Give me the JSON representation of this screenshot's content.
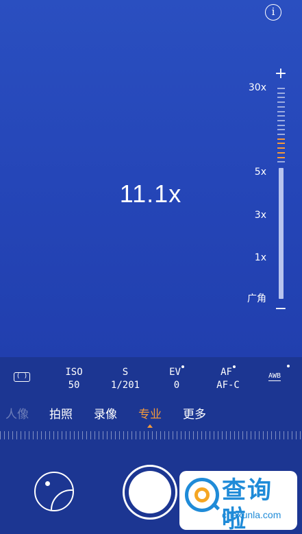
{
  "viewfinder": {
    "info_glyph": "i",
    "zoom_readout": "11.1x",
    "zoom_slider": {
      "plus": "+",
      "minus": "−",
      "labels": [
        "30x",
        "5x",
        "3x",
        "1x",
        "广角"
      ],
      "level_fraction": 0.62
    }
  },
  "pro_params": {
    "aspect_glyph": "(  )",
    "iso": {
      "name": "ISO",
      "value": "50"
    },
    "shutter": {
      "name": "S",
      "value": "1/201"
    },
    "ev": {
      "name": "EV",
      "value": "0"
    },
    "af": {
      "name": "AF",
      "value": "AF-C"
    },
    "awb": "AWB"
  },
  "modes": [
    "人像",
    "拍照",
    "录像",
    "专业",
    "更多"
  ],
  "active_mode": "专业",
  "watermark": {
    "title": "查询啦",
    "subtitle": "chaxunla.com"
  },
  "colors": {
    "accent": "#f59a3b",
    "brand": "#1f8bd8",
    "background": "#1f3fa9"
  },
  "icons": {
    "info": "info-icon",
    "aspect": "aspect-ratio-icon",
    "gallery": "gallery-icon",
    "shutter": "shutter-icon"
  }
}
